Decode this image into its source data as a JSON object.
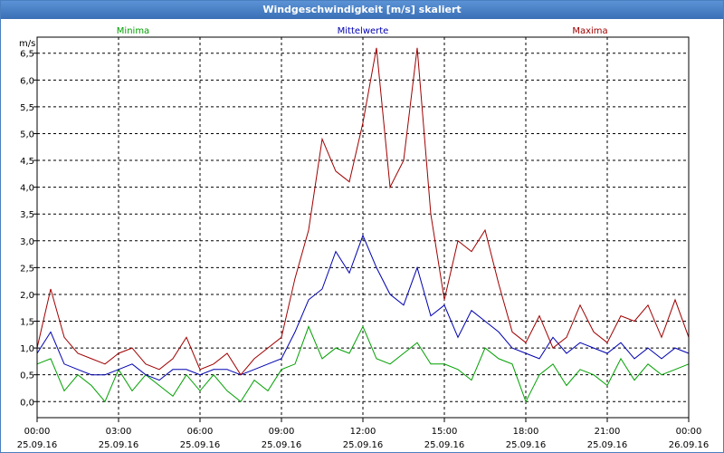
{
  "window": {
    "title": "Windgeschwindigkeit [m/s] skaliert"
  },
  "colors": {
    "minima": "#00a000",
    "mittelwerte": "#0000b0",
    "maxima": "#a00000",
    "grid": "#000000",
    "titlebar": "#3a6fb5"
  },
  "chart_data": {
    "type": "line",
    "title": "Windgeschwindigkeit [m/s] skaliert",
    "ylabel": "m/s",
    "xlabel": "",
    "ylim": [
      -0.3,
      6.8
    ],
    "xlim": [
      0,
      24
    ],
    "grid": true,
    "legend_placement": "top",
    "y_ticks": [
      {
        "value": 0.0,
        "label": "0,0"
      },
      {
        "value": 0.5,
        "label": "0,5"
      },
      {
        "value": 1.0,
        "label": "1,0"
      },
      {
        "value": 1.5,
        "label": "1,5"
      },
      {
        "value": 2.0,
        "label": "2,0"
      },
      {
        "value": 2.5,
        "label": "2,5"
      },
      {
        "value": 3.0,
        "label": "3,0"
      },
      {
        "value": 3.5,
        "label": "3,5"
      },
      {
        "value": 4.0,
        "label": "4,0"
      },
      {
        "value": 4.5,
        "label": "4,5"
      },
      {
        "value": 5.0,
        "label": "5,0"
      },
      {
        "value": 5.5,
        "label": "5,5"
      },
      {
        "value": 6.0,
        "label": "6,0"
      },
      {
        "value": 6.5,
        "label": "6,5"
      }
    ],
    "x_ticks": [
      {
        "value": 0,
        "time": "00:00",
        "date": "25.09.16"
      },
      {
        "value": 3,
        "time": "03:00",
        "date": "25.09.16"
      },
      {
        "value": 6,
        "time": "06:00",
        "date": "25.09.16"
      },
      {
        "value": 9,
        "time": "09:00",
        "date": "25.09.16"
      },
      {
        "value": 12,
        "time": "12:00",
        "date": "25.09.16"
      },
      {
        "value": 15,
        "time": "15:00",
        "date": "25.09.16"
      },
      {
        "value": 18,
        "time": "18:00",
        "date": "25.09.16"
      },
      {
        "value": 21,
        "time": "21:00",
        "date": "25.09.16"
      },
      {
        "value": 24,
        "time": "00:00",
        "date": "26.09.16"
      }
    ],
    "series": [
      {
        "name": "Minima",
        "color": "#00a000",
        "x": [
          0,
          0.5,
          1,
          1.5,
          2,
          2.5,
          3,
          3.5,
          4,
          4.5,
          5,
          5.5,
          6,
          6.5,
          7,
          7.5,
          8,
          8.5,
          9,
          9.5,
          10,
          10.5,
          11,
          11.5,
          12,
          12.5,
          13,
          13.5,
          14,
          14.5,
          15,
          15.5,
          16,
          16.5,
          17,
          17.5,
          18,
          18.5,
          19,
          19.5,
          20,
          20.5,
          21,
          21.5,
          22,
          22.5,
          23,
          23.5,
          24
        ],
        "values": [
          0.7,
          0.8,
          0.2,
          0.5,
          0.3,
          0.0,
          0.6,
          0.2,
          0.5,
          0.3,
          0.1,
          0.5,
          0.2,
          0.5,
          0.2,
          0.0,
          0.4,
          0.2,
          0.6,
          0.7,
          1.4,
          0.8,
          1.0,
          0.9,
          1.4,
          0.8,
          0.7,
          0.9,
          1.1,
          0.7,
          0.7,
          0.6,
          0.4,
          1.0,
          0.8,
          0.7,
          0.0,
          0.5,
          0.7,
          0.3,
          0.6,
          0.5,
          0.3,
          0.8,
          0.4,
          0.7,
          0.5,
          0.6,
          0.7
        ]
      },
      {
        "name": "Mittelwerte",
        "color": "#0000b0",
        "x": [
          0,
          0.5,
          1,
          1.5,
          2,
          2.5,
          3,
          3.5,
          4,
          4.5,
          5,
          5.5,
          6,
          6.5,
          7,
          7.5,
          8,
          8.5,
          9,
          9.5,
          10,
          10.5,
          11,
          11.5,
          12,
          12.5,
          13,
          13.5,
          14,
          14.5,
          15,
          15.5,
          16,
          16.5,
          17,
          17.5,
          18,
          18.5,
          19,
          19.5,
          20,
          20.5,
          21,
          21.5,
          22,
          22.5,
          23,
          23.5,
          24
        ],
        "values": [
          0.9,
          1.3,
          0.7,
          0.6,
          0.5,
          0.5,
          0.6,
          0.7,
          0.5,
          0.4,
          0.6,
          0.6,
          0.5,
          0.6,
          0.6,
          0.5,
          0.6,
          0.7,
          0.8,
          1.3,
          1.9,
          2.1,
          2.8,
          2.4,
          3.1,
          2.5,
          2.0,
          1.8,
          2.5,
          1.6,
          1.8,
          1.2,
          1.7,
          1.5,
          1.3,
          1.0,
          0.9,
          0.8,
          1.2,
          0.9,
          1.1,
          1.0,
          0.9,
          1.1,
          0.8,
          1.0,
          0.8,
          1.0,
          0.9
        ]
      },
      {
        "name": "Maxima",
        "color": "#a00000",
        "x": [
          0,
          0.5,
          1,
          1.5,
          2,
          2.5,
          3,
          3.5,
          4,
          4.5,
          5,
          5.5,
          6,
          6.5,
          7,
          7.5,
          8,
          8.5,
          9,
          9.5,
          10,
          10.5,
          11,
          11.5,
          12,
          12.5,
          13,
          13.5,
          14,
          14.5,
          15,
          15.5,
          16,
          16.5,
          17,
          17.5,
          18,
          18.5,
          19,
          19.5,
          20,
          20.5,
          21,
          21.5,
          22,
          22.5,
          23,
          23.5,
          24
        ],
        "values": [
          1.0,
          2.1,
          1.2,
          0.9,
          0.8,
          0.7,
          0.9,
          1.0,
          0.7,
          0.6,
          0.8,
          1.2,
          0.6,
          0.7,
          0.9,
          0.5,
          0.8,
          1.0,
          1.2,
          2.3,
          3.2,
          4.9,
          4.3,
          4.1,
          5.2,
          6.6,
          4.0,
          4.5,
          6.6,
          3.5,
          1.9,
          3.0,
          2.8,
          3.2,
          2.2,
          1.3,
          1.1,
          1.6,
          1.0,
          1.2,
          1.8,
          1.3,
          1.1,
          1.6,
          1.5,
          1.8,
          1.2,
          1.9,
          1.2
        ]
      }
    ]
  }
}
